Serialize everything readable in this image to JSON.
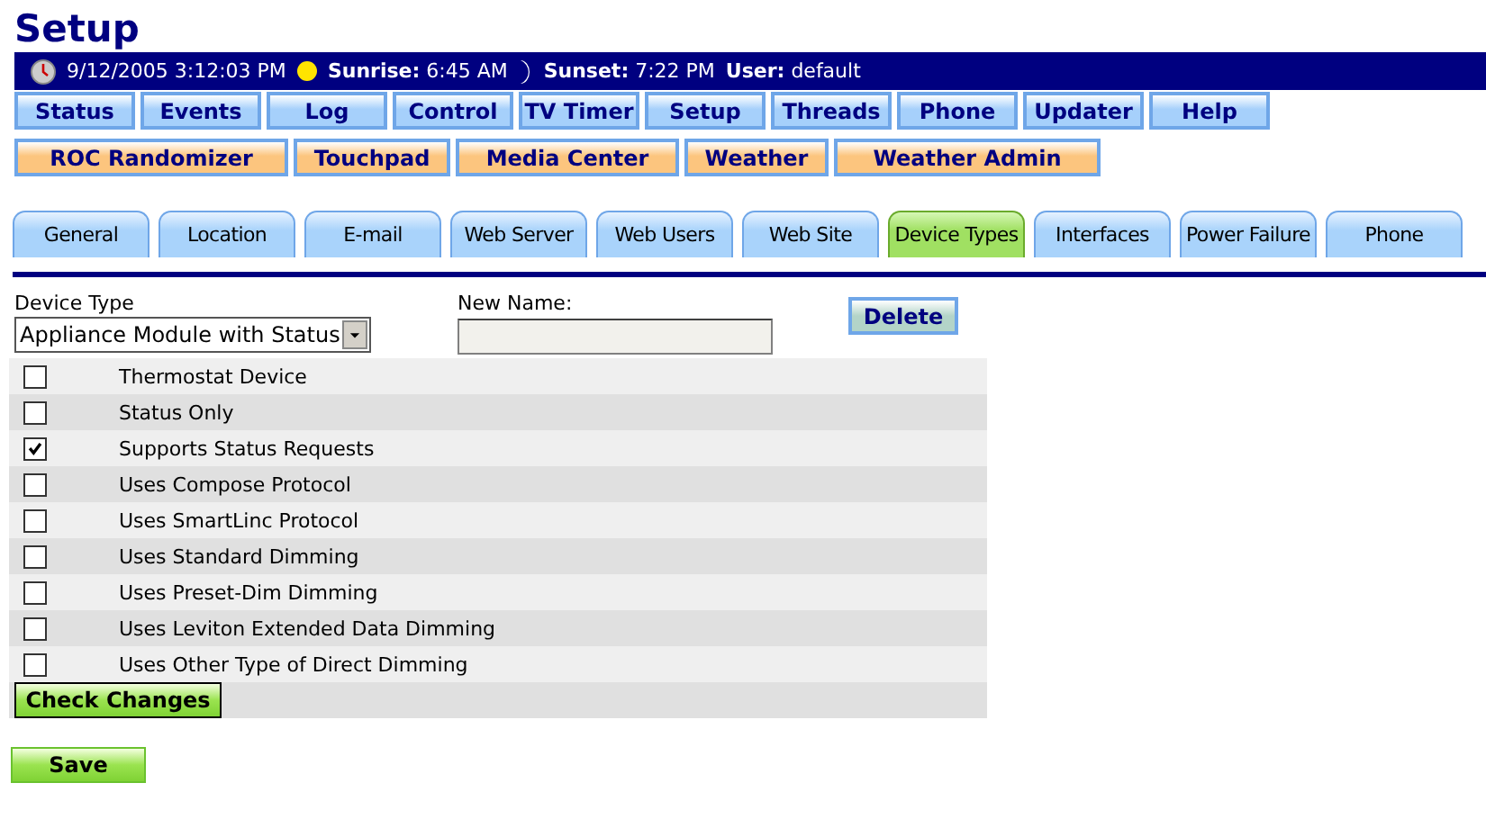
{
  "title": "Setup",
  "info_bar": {
    "datetime": "9/12/2005 3:12:03 PM",
    "sunrise_label": "Sunrise:",
    "sunrise": "6:45 AM",
    "sunset_label": "Sunset:",
    "sunset": "7:22 PM",
    "user_label": "User:",
    "user": "default"
  },
  "nav_primary": [
    "Status",
    "Events",
    "Log",
    "Control",
    "TV Timer",
    "Setup",
    "Threads",
    "Phone",
    "Updater",
    "Help"
  ],
  "nav_secondary": [
    "ROC Randomizer",
    "Touchpad",
    "Media Center",
    "Weather",
    "Weather Admin"
  ],
  "tabs": [
    {
      "label": "General",
      "selected": false
    },
    {
      "label": "Location",
      "selected": false
    },
    {
      "label": "E-mail",
      "selected": false
    },
    {
      "label": "Web Server",
      "selected": false
    },
    {
      "label": "Web Users",
      "selected": false
    },
    {
      "label": "Web Site",
      "selected": false
    },
    {
      "label": "Device Types",
      "selected": true
    },
    {
      "label": "Interfaces",
      "selected": false
    },
    {
      "label": "Power Failure",
      "selected": false
    },
    {
      "label": "Phone",
      "selected": false
    }
  ],
  "device_type": {
    "label": "Device Type",
    "value": "Appliance Module with Status"
  },
  "new_name": {
    "label": "New Name:"
  },
  "delete_button": "Delete",
  "options": [
    {
      "label": "Thermostat Device",
      "checked": false
    },
    {
      "label": "Status Only",
      "checked": false
    },
    {
      "label": "Supports Status Requests",
      "checked": true
    },
    {
      "label": "Uses Compose Protocol",
      "checked": false
    },
    {
      "label": "Uses SmartLinc Protocol",
      "checked": false
    },
    {
      "label": "Uses Standard Dimming",
      "checked": false
    },
    {
      "label": "Uses Preset-Dim Dimming",
      "checked": false
    },
    {
      "label": "Uses Leviton Extended Data Dimming",
      "checked": false
    },
    {
      "label": "Uses Other Type of Direct Dimming",
      "checked": false
    }
  ],
  "check_changes_button": "Check Changes",
  "save_button": "Save"
}
